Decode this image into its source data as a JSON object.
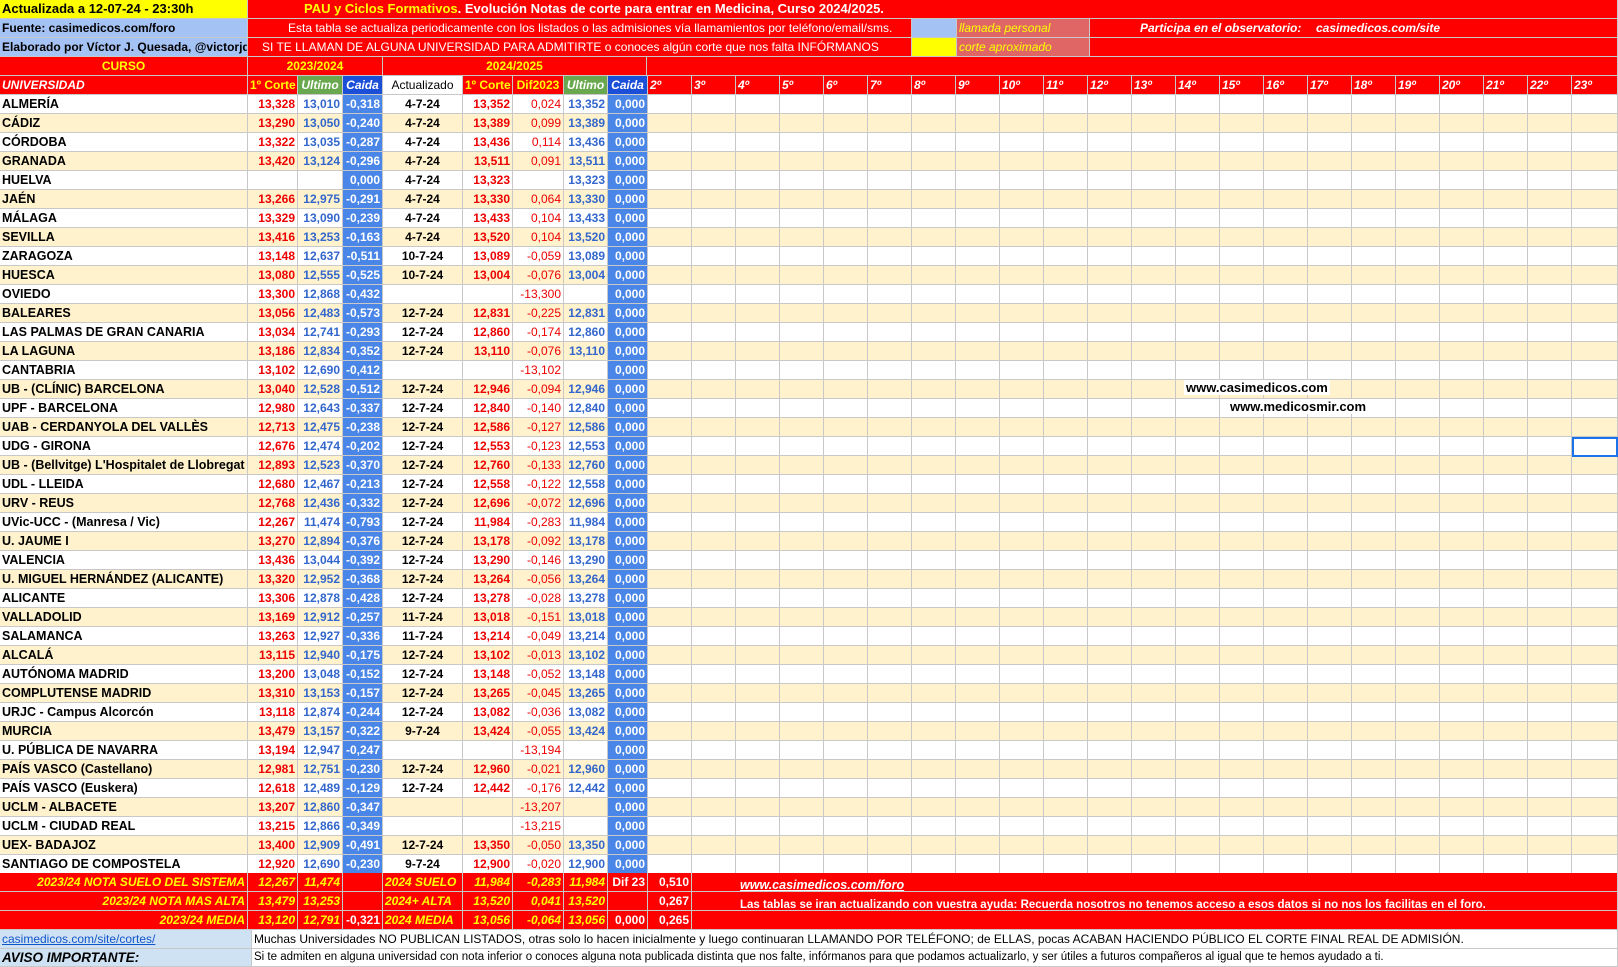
{
  "header": {
    "updated": "Actualizada a 12-07-24 - 23:30h",
    "source": "Fuente: casimedicos.com/foro",
    "author": "Elaborado por Víctor J. Quesada, @victorjqv",
    "title_pre": "PAU y Ciclos Formativos",
    "title_post": ". Evolución Notas de corte para entrar en Medicina, Curso 2024/2025.",
    "note1": "Esta tabla se actualiza periodicamente con los listados o las admisiones vía llamamientos por teléfono/email/sms.",
    "note2": "SI TE LLAMAN DE ALGUNA UNIVERSIDAD PARA ADMITIRTE o conoces algún corte que nos falta INFÓRMANOS",
    "legend_call": "llamada personal",
    "legend_approx": "corte aproximado",
    "observatorio": "Participa en el observatorio:",
    "site": "casimedicos.com/site",
    "curso": "CURSO",
    "year_2023": "2023/2024",
    "year_2024": "2024/2025"
  },
  "columns": {
    "universidad": "UNIVERSIDAD",
    "primer_corte": "1º Corte",
    "ultimo": "Ultimo",
    "caida": "Caida",
    "actualizado": "Actualizado",
    "primer_corte_24": "1º Corte",
    "dif2023": "Dif2023",
    "ultimo_24": "Ultimo",
    "caida_24": "Caida",
    "rounds": [
      "2º",
      "3º",
      "4º",
      "5º",
      "6º",
      "7º",
      "8º",
      "9º",
      "10º",
      "11º",
      "12º",
      "13º",
      "14º",
      "15º",
      "16º",
      "17º",
      "18º",
      "19º",
      "20º",
      "21º",
      "22º",
      "23º"
    ]
  },
  "rows": [
    {
      "u": "ALMERÍA",
      "c1": "13,328",
      "ul": "13,010",
      "ca": "-0,318",
      "act": "4-7-24",
      "c24": "13,352",
      "dif": "0,024",
      "u24": "13,352",
      "ca24": "0,000"
    },
    {
      "u": "CÁDIZ",
      "c1": "13,290",
      "ul": "13,050",
      "ca": "-0,240",
      "act": "4-7-24",
      "c24": "13,389",
      "dif": "0,099",
      "u24": "13,389",
      "ca24": "0,000"
    },
    {
      "u": "CÓRDOBA",
      "c1": "13,322",
      "ul": "13,035",
      "ca": "-0,287",
      "act": "4-7-24",
      "c24": "13,436",
      "dif": "0,114",
      "u24": "13,436",
      "ca24": "0,000"
    },
    {
      "u": "GRANADA",
      "c1": "13,420",
      "ul": "13,124",
      "ca": "-0,296",
      "act": "4-7-24",
      "c24": "13,511",
      "dif": "0,091",
      "u24": "13,511",
      "ca24": "0,000"
    },
    {
      "u": "HUELVA",
      "c1": "",
      "ul": "",
      "ca": "0,000",
      "act": "4-7-24",
      "c24": "13,323",
      "dif": "",
      "u24": "13,323",
      "ca24": "0,000"
    },
    {
      "u": "JAÉN",
      "c1": "13,266",
      "ul": "12,975",
      "ca": "-0,291",
      "act": "4-7-24",
      "c24": "13,330",
      "dif": "0,064",
      "u24": "13,330",
      "ca24": "0,000"
    },
    {
      "u": "MÁLAGA",
      "c1": "13,329",
      "ul": "13,090",
      "ca": "-0,239",
      "act": "4-7-24",
      "c24": "13,433",
      "dif": "0,104",
      "u24": "13,433",
      "ca24": "0,000"
    },
    {
      "u": "SEVILLA",
      "c1": "13,416",
      "ul": "13,253",
      "ca": "-0,163",
      "act": "4-7-24",
      "c24": "13,520",
      "dif": "0,104",
      "u24": "13,520",
      "ca24": "0,000"
    },
    {
      "u": "ZARAGOZA",
      "c1": "13,148",
      "ul": "12,637",
      "ca": "-0,511",
      "act": "10-7-24",
      "c24": "13,089",
      "dif": "-0,059",
      "u24": "13,089",
      "ca24": "0,000"
    },
    {
      "u": "HUESCA",
      "c1": "13,080",
      "ul": "12,555",
      "ca": "-0,525",
      "act": "10-7-24",
      "c24": "13,004",
      "dif": "-0,076",
      "u24": "13,004",
      "ca24": "0,000"
    },
    {
      "u": "OVIEDO",
      "c1": "13,300",
      "ul": "12,868",
      "ca": "-0,432",
      "act": "",
      "c24": "",
      "dif": "-13,300",
      "u24": "",
      "ca24": "0,000"
    },
    {
      "u": "BALEARES",
      "c1": "13,056",
      "ul": "12,483",
      "ca": "-0,573",
      "act": "12-7-24",
      "c24": "12,831",
      "dif": "-0,225",
      "u24": "12,831",
      "ca24": "0,000"
    },
    {
      "u": "LAS PALMAS DE GRAN CANARIA",
      "c1": "13,034",
      "ul": "12,741",
      "ca": "-0,293",
      "act": "12-7-24",
      "c24": "12,860",
      "dif": "-0,174",
      "u24": "12,860",
      "ca24": "0,000"
    },
    {
      "u": "LA LAGUNA",
      "c1": "13,186",
      "ul": "12,834",
      "ca": "-0,352",
      "act": "12-7-24",
      "c24": "13,110",
      "dif": "-0,076",
      "u24": "13,110",
      "ca24": "0,000"
    },
    {
      "u": "CANTABRIA",
      "c1": "13,102",
      "ul": "12,690",
      "ca": "-0,412",
      "act": "",
      "c24": "",
      "dif": "-13,102",
      "u24": "",
      "ca24": "0,000"
    },
    {
      "u": "UB - (CLÍNIC) BARCELONA",
      "c1": "13,040",
      "ul": "12,528",
      "ca": "-0,512",
      "act": "12-7-24",
      "c24": "12,946",
      "dif": "-0,094",
      "u24": "12,946",
      "ca24": "0,000"
    },
    {
      "u": "UPF - BARCELONA",
      "c1": "12,980",
      "ul": "12,643",
      "ca": "-0,337",
      "act": "12-7-24",
      "c24": "12,840",
      "dif": "-0,140",
      "u24": "12,840",
      "ca24": "0,000"
    },
    {
      "u": "UAB - CERDANYOLA DEL VALLÈS",
      "c1": "12,713",
      "ul": "12,475",
      "ca": "-0,238",
      "act": "12-7-24",
      "c24": "12,586",
      "dif": "-0,127",
      "u24": "12,586",
      "ca24": "0,000"
    },
    {
      "u": "UDG - GIRONA",
      "c1": "12,676",
      "ul": "12,474",
      "ca": "-0,202",
      "act": "12-7-24",
      "c24": "12,553",
      "dif": "-0,123",
      "u24": "12,553",
      "ca24": "0,000"
    },
    {
      "u": "UB - (Bellvitge) L'Hospitalet de Llobregat",
      "c1": "12,893",
      "ul": "12,523",
      "ca": "-0,370",
      "act": "12-7-24",
      "c24": "12,760",
      "dif": "-0,133",
      "u24": "12,760",
      "ca24": "0,000"
    },
    {
      "u": "UDL - LLEIDA",
      "c1": "12,680",
      "ul": "12,467",
      "ca": "-0,213",
      "act": "12-7-24",
      "c24": "12,558",
      "dif": "-0,122",
      "u24": "12,558",
      "ca24": "0,000"
    },
    {
      "u": "URV - REUS",
      "c1": "12,768",
      "ul": "12,436",
      "ca": "-0,332",
      "act": "12-7-24",
      "c24": "12,696",
      "dif": "-0,072",
      "u24": "12,696",
      "ca24": "0,000"
    },
    {
      "u": "UVic-UCC - (Manresa / Vic)",
      "c1": "12,267",
      "ul": "11,474",
      "ca": "-0,793",
      "act": "12-7-24",
      "c24": "11,984",
      "dif": "-0,283",
      "u24": "11,984",
      "ca24": "0,000"
    },
    {
      "u": "U. JAUME I",
      "c1": "13,270",
      "ul": "12,894",
      "ca": "-0,376",
      "act": "12-7-24",
      "c24": "13,178",
      "dif": "-0,092",
      "u24": "13,178",
      "ca24": "0,000"
    },
    {
      "u": "VALENCIA",
      "c1": "13,436",
      "ul": "13,044",
      "ca": "-0,392",
      "act": "12-7-24",
      "c24": "13,290",
      "dif": "-0,146",
      "u24": "13,290",
      "ca24": "0,000"
    },
    {
      "u": "U. MIGUEL HERNÁNDEZ (ALICANTE)",
      "c1": "13,320",
      "ul": "12,952",
      "ca": "-0,368",
      "act": "12-7-24",
      "c24": "13,264",
      "dif": "-0,056",
      "u24": "13,264",
      "ca24": "0,000"
    },
    {
      "u": "ALICANTE",
      "c1": "13,306",
      "ul": "12,878",
      "ca": "-0,428",
      "act": "12-7-24",
      "c24": "13,278",
      "dif": "-0,028",
      "u24": "13,278",
      "ca24": "0,000"
    },
    {
      "u": "VALLADOLID",
      "c1": "13,169",
      "ul": "12,912",
      "ca": "-0,257",
      "act": "11-7-24",
      "c24": "13,018",
      "dif": "-0,151",
      "u24": "13,018",
      "ca24": "0,000"
    },
    {
      "u": "SALAMANCA",
      "c1": "13,263",
      "ul": "12,927",
      "ca": "-0,336",
      "act": "11-7-24",
      "c24": "13,214",
      "dif": "-0,049",
      "u24": "13,214",
      "ca24": "0,000"
    },
    {
      "u": "ALCALÁ",
      "c1": "13,115",
      "ul": "12,940",
      "ca": "-0,175",
      "act": "12-7-24",
      "c24": "13,102",
      "dif": "-0,013",
      "u24": "13,102",
      "ca24": "0,000"
    },
    {
      "u": "AUTÓNOMA MADRID",
      "c1": "13,200",
      "ul": "13,048",
      "ca": "-0,152",
      "act": "12-7-24",
      "c24": "13,148",
      "dif": "-0,052",
      "u24": "13,148",
      "ca24": "0,000"
    },
    {
      "u": "COMPLUTENSE MADRID",
      "c1": "13,310",
      "ul": "13,153",
      "ca": "-0,157",
      "act": "12-7-24",
      "c24": "13,265",
      "dif": "-0,045",
      "u24": "13,265",
      "ca24": "0,000"
    },
    {
      "u": "URJC - Campus Alcorcón",
      "c1": "13,118",
      "ul": "12,874",
      "ca": "-0,244",
      "act": "12-7-24",
      "c24": "13,082",
      "dif": "-0,036",
      "u24": "13,082",
      "ca24": "0,000"
    },
    {
      "u": "MURCIA",
      "c1": "13,479",
      "ul": "13,157",
      "ca": "-0,322",
      "act": "9-7-24",
      "c24": "13,424",
      "dif": "-0,055",
      "u24": "13,424",
      "ca24": "0,000"
    },
    {
      "u": "U. PÚBLICA DE NAVARRA",
      "c1": "13,194",
      "ul": "12,947",
      "ca": "-0,247",
      "act": "",
      "c24": "",
      "dif": "-13,194",
      "u24": "",
      "ca24": "0,000"
    },
    {
      "u": "PAÍS VASCO (Castellano)",
      "c1": "12,981",
      "ul": "12,751",
      "ca": "-0,230",
      "act": "12-7-24",
      "c24": "12,960",
      "dif": "-0,021",
      "u24": "12,960",
      "ca24": "0,000"
    },
    {
      "u": "PAÍS VASCO (Euskera)",
      "c1": "12,618",
      "ul": "12,489",
      "ca": "-0,129",
      "act": "12-7-24",
      "c24": "12,442",
      "dif": "-0,176",
      "u24": "12,442",
      "ca24": "0,000"
    },
    {
      "u": "UCLM - ALBACETE",
      "c1": "13,207",
      "ul": "12,860",
      "ca": "-0,347",
      "act": "",
      "c24": "",
      "dif": "-13,207",
      "u24": "",
      "ca24": "0,000"
    },
    {
      "u": "UCLM - CIUDAD REAL",
      "c1": "13,215",
      "ul": "12,866",
      "ca": "-0,349",
      "act": "",
      "c24": "",
      "dif": "-13,215",
      "u24": "",
      "ca24": "0,000"
    },
    {
      "u": "UEX- BADAJOZ",
      "c1": "13,400",
      "ul": "12,909",
      "ca": "-0,491",
      "act": "12-7-24",
      "c24": "13,350",
      "dif": "-0,050",
      "u24": "13,350",
      "ca24": "0,000"
    },
    {
      "u": "SANTIAGO DE COMPOSTELA",
      "c1": "12,920",
      "ul": "12,690",
      "ca": "-0,230",
      "act": "9-7-24",
      "c24": "12,900",
      "dif": "-0,020",
      "u24": "12,900",
      "ca24": "0,000"
    }
  ],
  "footer": [
    {
      "label": "2023/24 NOTA SUELO DEL SISTEMA",
      "c1": "12,267",
      "ul": "11,474",
      "ca": "",
      "label24": "2024 SUELO",
      "c24": "11,984",
      "dif": "-0,283",
      "u24": "11,984",
      "x1": "Dif 23",
      "x2": "0,510"
    },
    {
      "label": "2023/24 NOTA MAS ALTA",
      "c1": "13,479",
      "ul": "13,253",
      "ca": "",
      "label24": "2024+ ALTA",
      "c24": "13,520",
      "dif": "0,041",
      "u24": "13,520",
      "x1": "",
      "x2": "0,267"
    },
    {
      "label": "2023/24 MEDIA",
      "c1": "13,120",
      "ul": "12,791",
      "ca": "-0,321",
      "label24": "2024 MEDIA",
      "c24": "13,056",
      "dif": "-0,064",
      "u24": "13,056",
      "x1": "0,000",
      "x2": "0,265"
    }
  ],
  "footer_notes": {
    "link": "www.casimedicos.com/foro",
    "text": "Las tablas se iran actualizando con vuestra ayuda: Recuerda nosotros no tenemos acceso a esos datos si no nos los facilitas en el foro."
  },
  "overlay": {
    "site1": "www.casimedicos.com",
    "site2": "www.medicosmir.com"
  },
  "bottom": {
    "link": "casimedicos.com/site/cortes/",
    "line1": "Muchas Universidades NO PUBLICAN LISTADOS, otras solo lo hacen inicialmente y luego continuaran LLAMANDO POR TELÉFONO; de ELLAS, pocas ACABAN HACIENDO PÚBLICO EL CORTE FINAL REAL DE ADMISIÓN.",
    "aviso": "AVISO IMPORTANTE:",
    "line2": "Si te admiten en alguna universidad con nota inferior o conoces alguna nota publicada distinta que nos falte, infórmanos para que podamos actualizarlo, y ser útiles a futuros compañeros al igual que te hemos ayudado a ti."
  }
}
